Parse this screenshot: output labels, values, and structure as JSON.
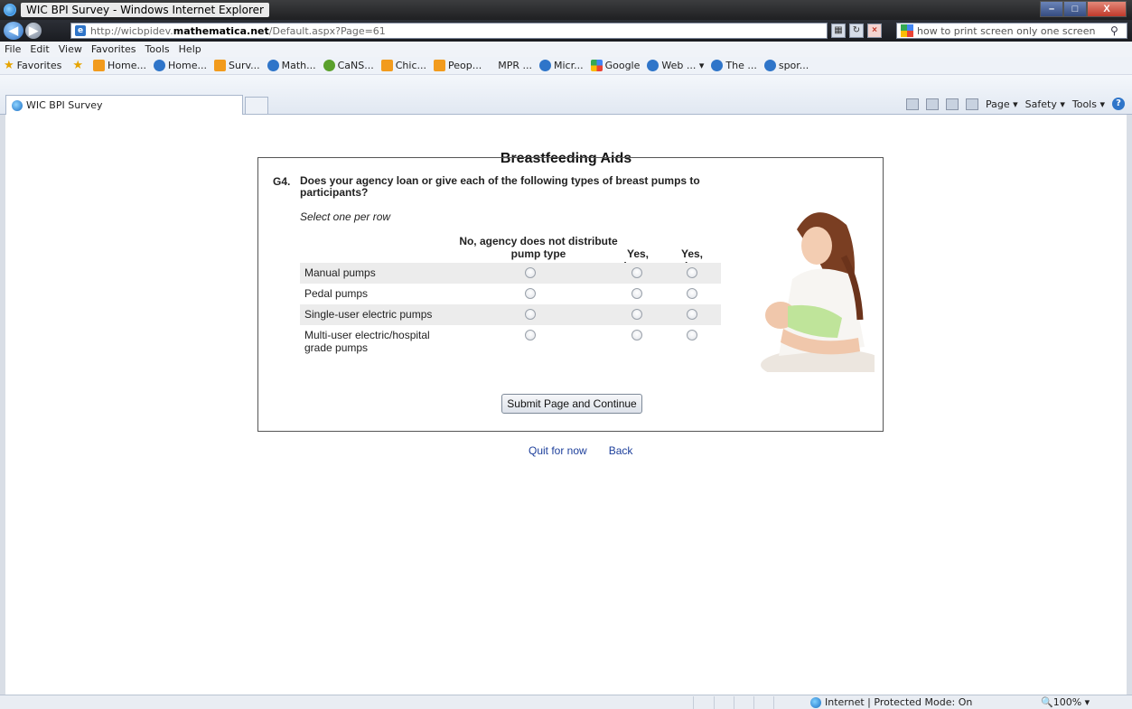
{
  "window": {
    "title": "WIC BPI Survey - Windows Internet Explorer",
    "min": "–",
    "max": "□",
    "close": "X"
  },
  "address": {
    "url_prefix": "http://wicbpidev.",
    "url_domain": "mathematica.net",
    "url_suffix": "/Default.aspx?Page=61",
    "search_text": "how to print screen only one screen"
  },
  "menu": [
    "File",
    "Edit",
    "View",
    "Favorites",
    "Tools",
    "Help"
  ],
  "favorites": {
    "label": "Favorites",
    "items": [
      {
        "label": "Home...",
        "icon": "orange"
      },
      {
        "label": "Home...",
        "icon": "blue"
      },
      {
        "label": "Surv...",
        "icon": "orange"
      },
      {
        "label": "Math...",
        "icon": "blue"
      },
      {
        "label": "CaNS...",
        "icon": "green"
      },
      {
        "label": "Chic...",
        "icon": "orange"
      },
      {
        "label": "Peop...",
        "icon": "orange"
      },
      {
        "label": "MPR ...",
        "icon": "none"
      },
      {
        "label": "Micr...",
        "icon": "blue"
      },
      {
        "label": "Google",
        "icon": "google"
      },
      {
        "label": "Web ... ▾",
        "icon": "blue"
      },
      {
        "label": "The ...",
        "icon": "blue"
      },
      {
        "label": "spor...",
        "icon": "blue"
      }
    ]
  },
  "tab": {
    "label": "WIC BPI Survey"
  },
  "commands": {
    "page": "Page ▾",
    "safety": "Safety ▾",
    "tools": "Tools ▾"
  },
  "content": {
    "title": "Breastfeeding Aids",
    "question_number": "G4.",
    "question_text": "Does your agency loan or give each of the following types of breast pumps to participants?",
    "instruction": "Select one per row",
    "columns": {
      "no": "No, agency does not distribute pump type",
      "loans": "Yes, loans",
      "gives": "Yes, gives"
    },
    "rows": [
      {
        "label": "Manual pumps"
      },
      {
        "label": "Pedal pumps"
      },
      {
        "label": "Single-user electric pumps"
      },
      {
        "label": "Multi-user electric/hospital grade pumps"
      }
    ],
    "submit": "Submit Page and Continue",
    "quit": "Quit for now",
    "back": "Back"
  },
  "status": {
    "zone": "Internet | Protected Mode: On",
    "zoom": "🔍100%  ▾"
  }
}
